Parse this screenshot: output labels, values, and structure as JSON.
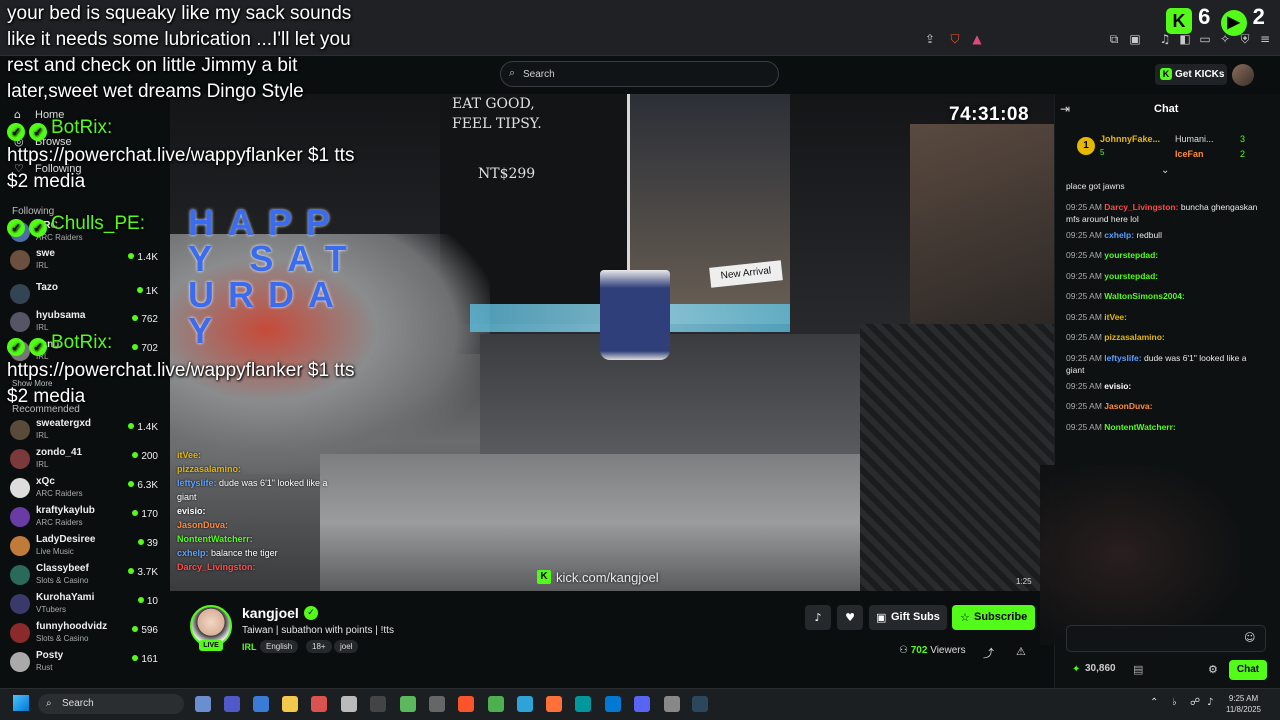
{
  "browser": {
    "icons": [
      "share-icon",
      "brave-shield-icon",
      "brave-rewards-icon",
      "extensions-icon",
      "media-icon",
      "sidebar-icon",
      "wallet-icon",
      "leo-icon",
      "vpn-icon",
      "menu-icon"
    ]
  },
  "header": {
    "logo": "KICK",
    "search_placeholder": "Search",
    "get_kicks_label": "Get KICKs"
  },
  "sidebar": {
    "nav": [
      {
        "label": "Home",
        "icon": "home-icon"
      },
      {
        "label": "Browse",
        "icon": "browse-icon"
      },
      {
        "label": "Following",
        "icon": "heart-icon"
      }
    ],
    "following_header": "Following",
    "following": [
      {
        "name": "ARC",
        "category": "ARC Raiders",
        "viewers": "",
        "color": "#4a6fa5"
      },
      {
        "name": "swe",
        "category": "IRL",
        "viewers": "1.4K",
        "color": "#6b4f3f"
      },
      {
        "name": "Tazo",
        "category": "",
        "viewers": "1K",
        "color": "#345"
      },
      {
        "name": "hyubsama",
        "category": "IRL",
        "viewers": "762",
        "color": "#556"
      },
      {
        "name": "kang",
        "category": "IRL",
        "viewers": "702",
        "color": "#777"
      }
    ],
    "show_more": "Show More",
    "recommended_header": "Recommended",
    "recommended": [
      {
        "name": "sweatergxd",
        "category": "IRL",
        "viewers": "1.4K",
        "color": "#5a4a3a"
      },
      {
        "name": "zondo_41",
        "category": "IRL",
        "viewers": "200",
        "color": "#7a3a3a"
      },
      {
        "name": "xQc",
        "category": "ARC Raiders",
        "viewers": "6.3K",
        "color": "#ddd"
      },
      {
        "name": "kraftykaylub",
        "category": "ARC Raiders",
        "viewers": "170",
        "color": "#6a3aa5"
      },
      {
        "name": "LadyDesiree",
        "category": "Live Music",
        "viewers": "39",
        "color": "#c07a3a"
      },
      {
        "name": "Classybeef",
        "category": "Slots & Casino",
        "viewers": "3.7K",
        "color": "#2a6a5a"
      },
      {
        "name": "KurohaYami",
        "category": "VTubers",
        "viewers": "10",
        "color": "#3a3a6a"
      },
      {
        "name": "funnyhoodvidz",
        "category": "Slots & Casino",
        "viewers": "596",
        "color": "#8a2a2a"
      },
      {
        "name": "Posty",
        "category": "Rust",
        "viewers": "161",
        "color": "#aaa"
      }
    ]
  },
  "overlay": {
    "alert_lines": [
      "your bed is squeaky like my sack sounds",
      "like it needs some lubrication ...I'll let you",
      "rest and check on little Jimmy a bit",
      "later,sweet wet dreams Dingo Style"
    ],
    "tts_1_user": "BotRix:",
    "tts_1_text_a": "https://powerchat.live/wappyflanker $1 tts",
    "tts_1_text_b": "$2 media",
    "tts_2_user": "Chulls_PE:",
    "tts_2_text": "HAPPY SATURDAY",
    "tts_3_user": "BotRix:",
    "tts_3_text_a": "https://powerchat.live/wappyflanker $1 tts",
    "tts_3_text_b": "$2 media",
    "counter_a": "6",
    "counter_b": "2"
  },
  "video": {
    "timer": "74:31:08",
    "watermark": "kick.com/kangjoel",
    "sign_1": "EAT GOOD,",
    "sign_2": "FEEL TIPSY.",
    "sign_3": "NT$299",
    "sign_4": "New Arrival",
    "overlay_chat": [
      {
        "user": "itVee:",
        "text": "",
        "color": "#e6b800"
      },
      {
        "user": "pizzasalamino:",
        "text": "",
        "color": "#e6b800"
      },
      {
        "user": "leftyslife:",
        "text": "dude was 6'1\" looked like a",
        "color": "#5aa0ff"
      },
      {
        "user": "",
        "text": "giant",
        "color": "#fff"
      },
      {
        "user": "evisio:",
        "text": "",
        "color": "#fff"
      },
      {
        "user": "JasonDuva:",
        "text": "",
        "color": "#ff8a3a"
      },
      {
        "user": "NontentWatcherr:",
        "text": "",
        "color": "#53fc18"
      },
      {
        "user": "cxhelp:",
        "text": "balance the tiger",
        "color": "#5aa0ff"
      },
      {
        "user": "Darcy_Livingston:",
        "text": "",
        "color": "#ff4a4a"
      }
    ],
    "corner_time": "1:25"
  },
  "channel": {
    "name": "kangjoel",
    "live_label": "LIVE",
    "title": "Taiwan | subathon with points | !tts",
    "category": "IRL",
    "tags": [
      "English",
      "18+",
      "joel"
    ],
    "gift_subs_label": "Gift Subs",
    "subscribe_label": "Subscribe",
    "viewers": "702",
    "viewers_label": "Viewers"
  },
  "chat": {
    "title": "Chat",
    "leaderboard": [
      {
        "name": "JohnnyFake...",
        "count": "5"
      },
      {
        "name": "Humani...",
        "count": "3"
      },
      {
        "name": "IceFan",
        "count": "2"
      }
    ],
    "messages": [
      {
        "time": "",
        "user": "",
        "text": "place got jawns",
        "color": "#fff"
      },
      {
        "time": "09:25 AM",
        "user": "Darcy_Livingston:",
        "text": "buncha ghengaskan mfs around here lol",
        "color": "#ff4a4a"
      },
      {
        "time": "09:25 AM",
        "user": "cxhelp:",
        "text": "redbull",
        "color": "#5aa0ff"
      },
      {
        "time": "09:25 AM",
        "user": "yourstepdad:",
        "text": "",
        "color": "#53fc18"
      },
      {
        "time": "09:25 AM",
        "user": "yourstepdad:",
        "text": "",
        "color": "#53fc18"
      },
      {
        "time": "09:25 AM",
        "user": "WaltonSimons2004:",
        "text": "",
        "color": "#53fc18"
      },
      {
        "time": "09:25 AM",
        "user": "itVee:",
        "text": "",
        "color": "#e6b800"
      },
      {
        "time": "09:25 AM",
        "user": "pizzasalamino:",
        "text": "",
        "color": "#e6b800"
      },
      {
        "time": "09:25 AM",
        "user": "leftyslife:",
        "text": "dude was 6'1\" looked like a giant",
        "color": "#5aa0ff"
      },
      {
        "time": "09:25 AM",
        "user": "evisio:",
        "text": "",
        "color": "#fff"
      },
      {
        "time": "09:25 AM",
        "user": "JasonDuva:",
        "text": "",
        "color": "#ff8a3a"
      },
      {
        "time": "09:25 AM",
        "user": "NontentWatcherr:",
        "text": "",
        "color": "#53fc18"
      }
    ],
    "points": "30,860",
    "send_label": "Chat"
  },
  "taskbar": {
    "search_label": "Search",
    "time": "9:25 AM",
    "date": "11/8/2025"
  },
  "colors": {
    "accent": "#53fc18",
    "background": "#0b0e0f"
  }
}
